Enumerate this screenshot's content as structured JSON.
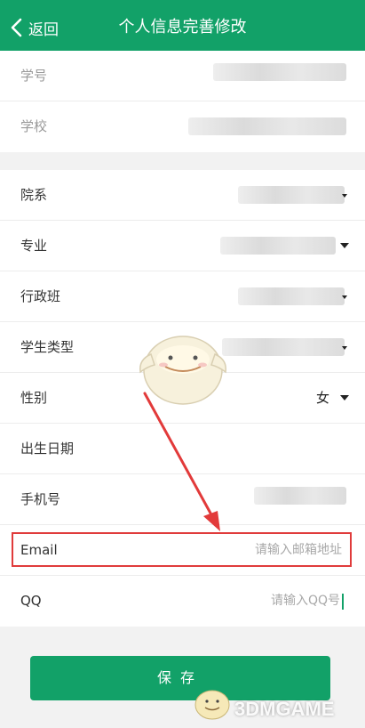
{
  "header": {
    "back_label": "返回",
    "title": "个人信息完善修改"
  },
  "fields": {
    "student_id": {
      "label": "学号"
    },
    "school": {
      "label": "学校"
    },
    "department": {
      "label": "院系"
    },
    "major": {
      "label": "专业"
    },
    "class": {
      "label": "行政班"
    },
    "student_type": {
      "label": "学生类型"
    },
    "gender": {
      "label": "性别",
      "value": "女"
    },
    "birthday": {
      "label": "出生日期"
    },
    "phone": {
      "label": "手机号"
    },
    "email": {
      "label": "Email",
      "placeholder": "请输入邮箱地址"
    },
    "qq": {
      "label": "QQ",
      "placeholder": "请输入QQ号"
    }
  },
  "save_button": {
    "label": "保存"
  },
  "watermark": "3DMGAME",
  "colors": {
    "brand": "#12a168",
    "highlight": "#e03b3b",
    "arrow": "#e23a3a"
  }
}
